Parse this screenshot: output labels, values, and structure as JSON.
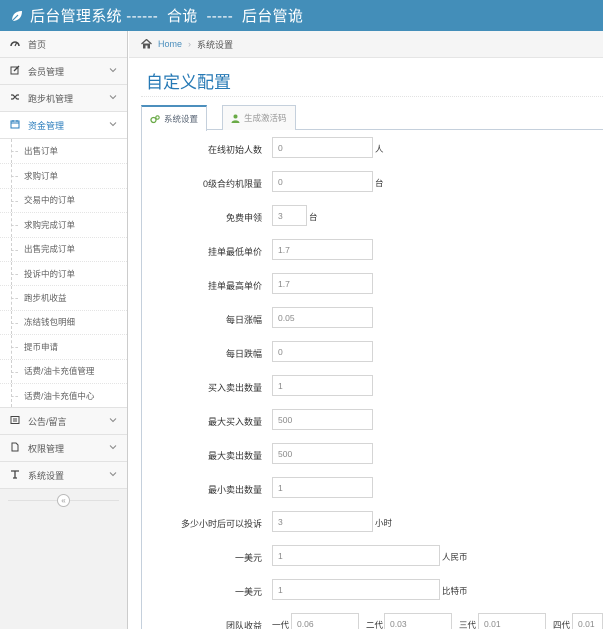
{
  "header": {
    "title": "后台管理系统 ------  合诡  -----  后台管诡"
  },
  "breadcrumb": {
    "home": "Home",
    "separator": "›",
    "current": "系统设置"
  },
  "sidebar": {
    "items": [
      {
        "label": "首页",
        "icon": "dashboard-icon"
      },
      {
        "label": "会员管理",
        "icon": "edit-icon"
      },
      {
        "label": "跑步机管理",
        "icon": "shuffle-icon"
      },
      {
        "label": "资金管理",
        "icon": "calendar-icon"
      }
    ],
    "sub_items": [
      "出售订单",
      "求购订单",
      "交易中的订单",
      "求购完成订单",
      "出售完成订单",
      "投诉中的订单",
      "跑步机收益",
      "冻结钱包明细",
      "提币申请",
      "话费/油卡充值管理",
      "话费/油卡充值中心"
    ],
    "bottom_items": [
      {
        "label": "公告/留言",
        "icon": "list-icon"
      },
      {
        "label": "权限管理",
        "icon": "file-icon"
      },
      {
        "label": "系统设置",
        "icon": "text-icon"
      }
    ],
    "collapse_glyph": "«"
  },
  "main": {
    "title": "自定义配置",
    "tabs": [
      "系统设置",
      "生成激活码"
    ]
  },
  "form": {
    "rows": [
      {
        "label": "在线初始人数",
        "value": "0",
        "unit": "人"
      },
      {
        "label": "0级合约机限量",
        "value": "0",
        "unit": "台"
      },
      {
        "label": "免费申领",
        "value": "3",
        "unit": "台"
      },
      {
        "label": "挂单最低单价",
        "value": "1.7",
        "unit": ""
      },
      {
        "label": "挂单最高单价",
        "value": "1.7",
        "unit": ""
      },
      {
        "label": "每日涨幅",
        "value": "0.05",
        "unit": ""
      },
      {
        "label": "每日跌幅",
        "value": "0",
        "unit": ""
      },
      {
        "label": "买入卖出数量",
        "value": "1",
        "unit": ""
      },
      {
        "label": "最大买入数量",
        "value": "500",
        "unit": ""
      },
      {
        "label": "最大卖出数量",
        "value": "500",
        "unit": ""
      },
      {
        "label": "最小卖出数量",
        "value": "1",
        "unit": ""
      },
      {
        "label": "多少小时后可以投诉",
        "value": "3",
        "unit": "小时"
      },
      {
        "label": "一美元",
        "value": "1",
        "unit": "人民币"
      },
      {
        "label": "一美元",
        "value": "1",
        "unit": "比特币"
      }
    ],
    "team_income": {
      "label": "团队收益",
      "gens": [
        {
          "label": "一代",
          "value": "0.06"
        },
        {
          "label": "二代",
          "value": "0.03"
        },
        {
          "label": "三代",
          "value": "0.01"
        },
        {
          "label": "四代",
          "value": "0.01"
        }
      ]
    }
  },
  "colors": {
    "topbar": "#438eb9",
    "accent": "#2679b5",
    "link": "#4c8fbd"
  }
}
